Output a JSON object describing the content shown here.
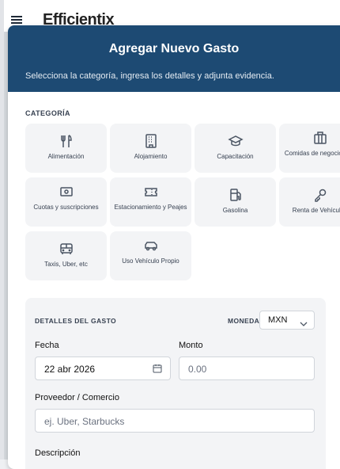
{
  "app": {
    "brand": "Efficientix"
  },
  "modal": {
    "title": "Agregar Nuevo Gasto",
    "subtitle": "Selecciona la categoría, ingresa los detalles y adjunta evidencia."
  },
  "categoria": {
    "label": "CATEGORÍA",
    "items": [
      {
        "label": "Alimentación",
        "icon": "utensils-icon"
      },
      {
        "label": "Alojamiento",
        "icon": "building-icon"
      },
      {
        "label": "Capacitación",
        "icon": "graduation-cap-icon"
      },
      {
        "label": "Comidas de negocios y...",
        "icon": "briefcase-icon"
      },
      {
        "label": "Cuotas y suscripciones",
        "icon": "banknote-icon"
      },
      {
        "label": "Estacionamiento y Peajes",
        "icon": "ticket-icon"
      },
      {
        "label": "Gasolina",
        "icon": "fuel-icon"
      },
      {
        "label": "Renta de Vehículos",
        "icon": "key-icon"
      },
      {
        "label": "Taxis, Uber, etc",
        "icon": "bus-icon"
      },
      {
        "label": "Uso Vehículo Propio",
        "icon": "car-icon"
      }
    ]
  },
  "detalles": {
    "label": "DETALLES DEL GASTO",
    "moneda_label": "MONEDA",
    "moneda_value": "MXN",
    "fecha_label": "Fecha",
    "fecha_value": "22 abr 2026",
    "monto_label": "Monto",
    "monto_placeholder": "0.00",
    "proveedor_label": "Proveedor / Comercio",
    "proveedor_placeholder": "ej. Uber, Starbucks",
    "descripcion_label": "Descripción"
  },
  "colors": {
    "header": "#1d4a73",
    "card": "#f3f4f6"
  }
}
